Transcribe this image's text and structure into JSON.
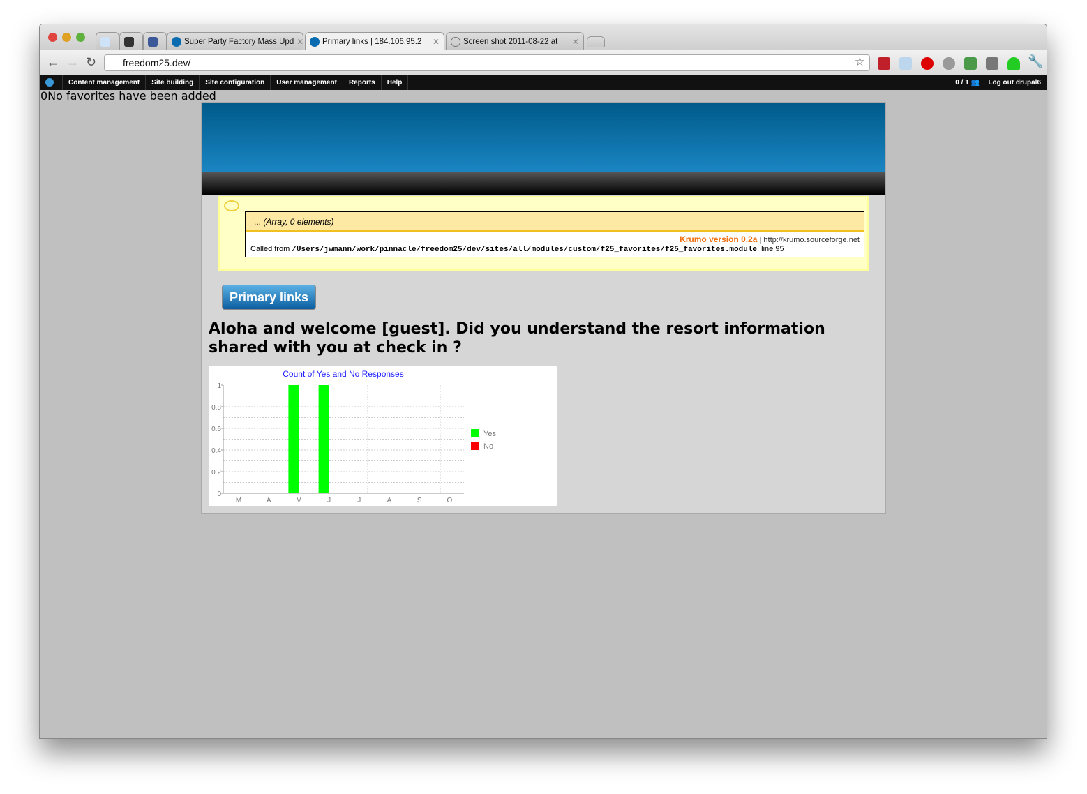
{
  "browser": {
    "tabs": [
      {
        "label": "",
        "icon": "reddit-icon"
      },
      {
        "label": "",
        "icon": "plus-icon"
      },
      {
        "label": "",
        "icon": "facebook-icon"
      },
      {
        "label": "Super Party Factory Mass Upd",
        "icon": "drupal-icon"
      },
      {
        "label": "Primary links | 184.106.95.2",
        "icon": "drupal-icon",
        "active": true
      },
      {
        "label": "Screen shot 2011-08-22 at",
        "icon": "globe-icon"
      }
    ],
    "url": "freedom25.dev/"
  },
  "admin_menu": {
    "items": [
      "Content management",
      "Site building",
      "Site configuration",
      "User management",
      "Reports",
      "Help"
    ],
    "users": "0 / 1",
    "logout": "Log out drupal6"
  },
  "favorites_message": "0No favorites have been added",
  "krumo": {
    "array_label": "...",
    "array_info": "(Array, 0 elements)",
    "version": "Krumo version 0.2a",
    "link": "http://krumo.sourceforge.net",
    "called_from": "Called from",
    "path": "/Users/jwmann/work/pinnacle/freedom25/dev/sites/all/modules/custom/f25_favorites/f25_favorites.module",
    "line": ", line 95"
  },
  "primary_links_button": "Primary links",
  "question": "Aloha and welcome [guest]. Did you understand the resort information shared with you at check in ?",
  "chart_data": {
    "type": "bar",
    "title": "Count of Yes and No Responses",
    "categories": [
      "M",
      "A",
      "M",
      "J",
      "J",
      "A",
      "S",
      "O"
    ],
    "series": [
      {
        "name": "Yes",
        "color": "#00ff00",
        "values": [
          0,
          0,
          1,
          1,
          0,
          0,
          0,
          0
        ]
      },
      {
        "name": "No",
        "color": "#ff0000",
        "values": [
          0,
          0,
          0,
          0,
          0,
          0,
          0,
          0
        ]
      }
    ],
    "ylim": [
      0,
      1
    ],
    "yticks": [
      "0",
      "0.2",
      "0.4",
      "0.6",
      "0.8",
      "1"
    ],
    "legend": "right",
    "grid": true
  }
}
